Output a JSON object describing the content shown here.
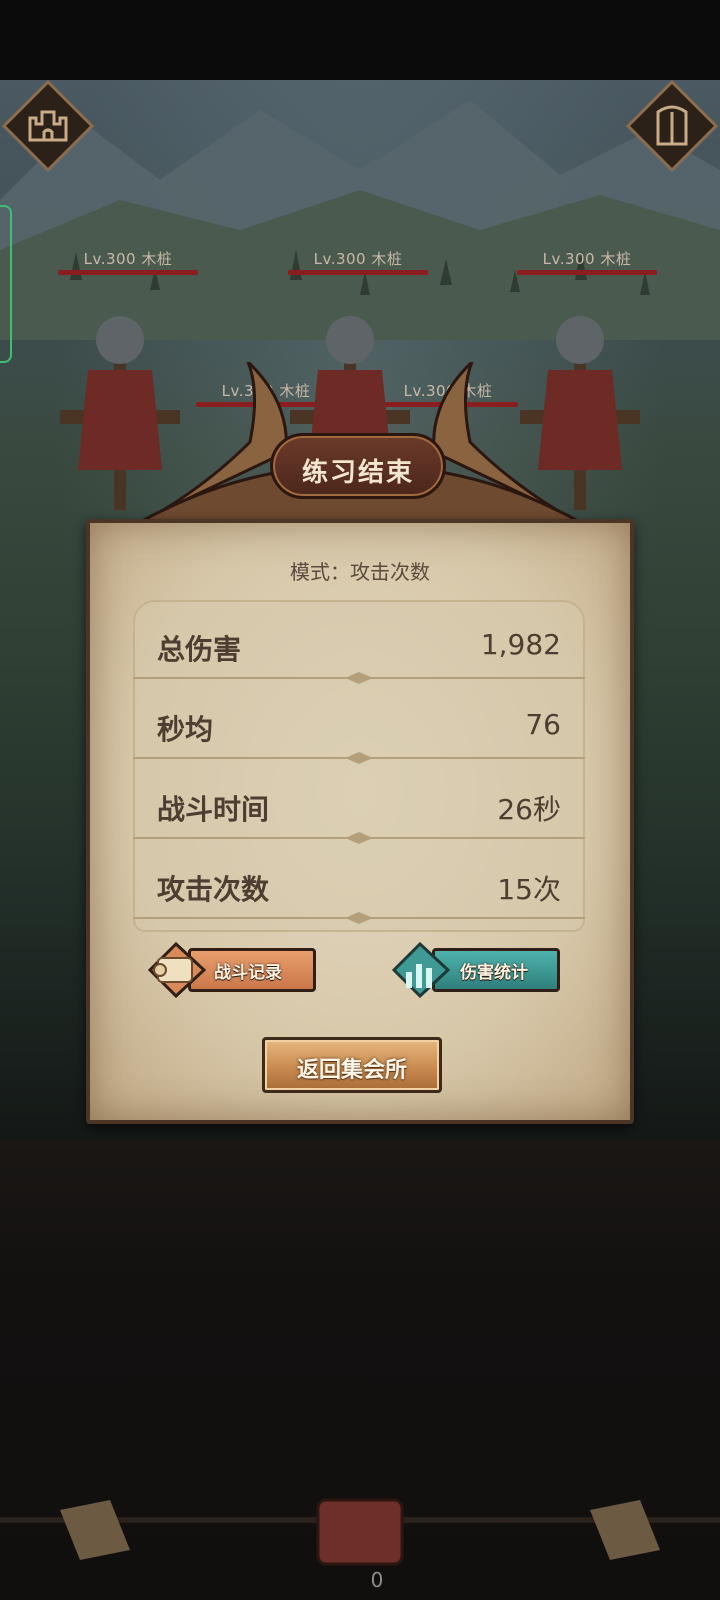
{
  "enemies": [
    {
      "label": "Lv.300  木桩",
      "hp_fraction": 1.0
    },
    {
      "label": "Lv.300  木桩",
      "hp_fraction": 1.0
    },
    {
      "label": "Lv.300  木桩",
      "hp_fraction": 1.0
    },
    {
      "label": "Lv.300  木桩",
      "hp_fraction": 1.0
    },
    {
      "label": "Lv.300  木桩",
      "hp_fraction": 1.0
    }
  ],
  "dialog": {
    "title": "练习结束",
    "mode": "模式：攻击次数",
    "stats": [
      {
        "label": "总伤害",
        "value": "1,982"
      },
      {
        "label": "秒均",
        "value": "76"
      },
      {
        "label": "战斗时间",
        "value": "26秒"
      },
      {
        "label": "攻击次数",
        "value": "15次"
      }
    ],
    "battle_log_button": "战斗记录",
    "damage_stats_button": "伤害统计",
    "return_button": "返回集会所"
  },
  "bottom": {
    "counter": "0"
  },
  "icons": {
    "top_left": "castle-icon",
    "top_right": "door-icon",
    "battle_log": "scroll-icon",
    "damage_stats": "bar-chart-icon",
    "bottom_center": "treasure-chest-icon"
  },
  "colors": {
    "paper": "#d7c7a9",
    "hp_bar": "#8a1e1e",
    "battle_log_button": "#d98a5a",
    "damage_stats_button": "#3f9a96",
    "return_button": "#c98b4f",
    "text_dark": "#4d3e31"
  }
}
